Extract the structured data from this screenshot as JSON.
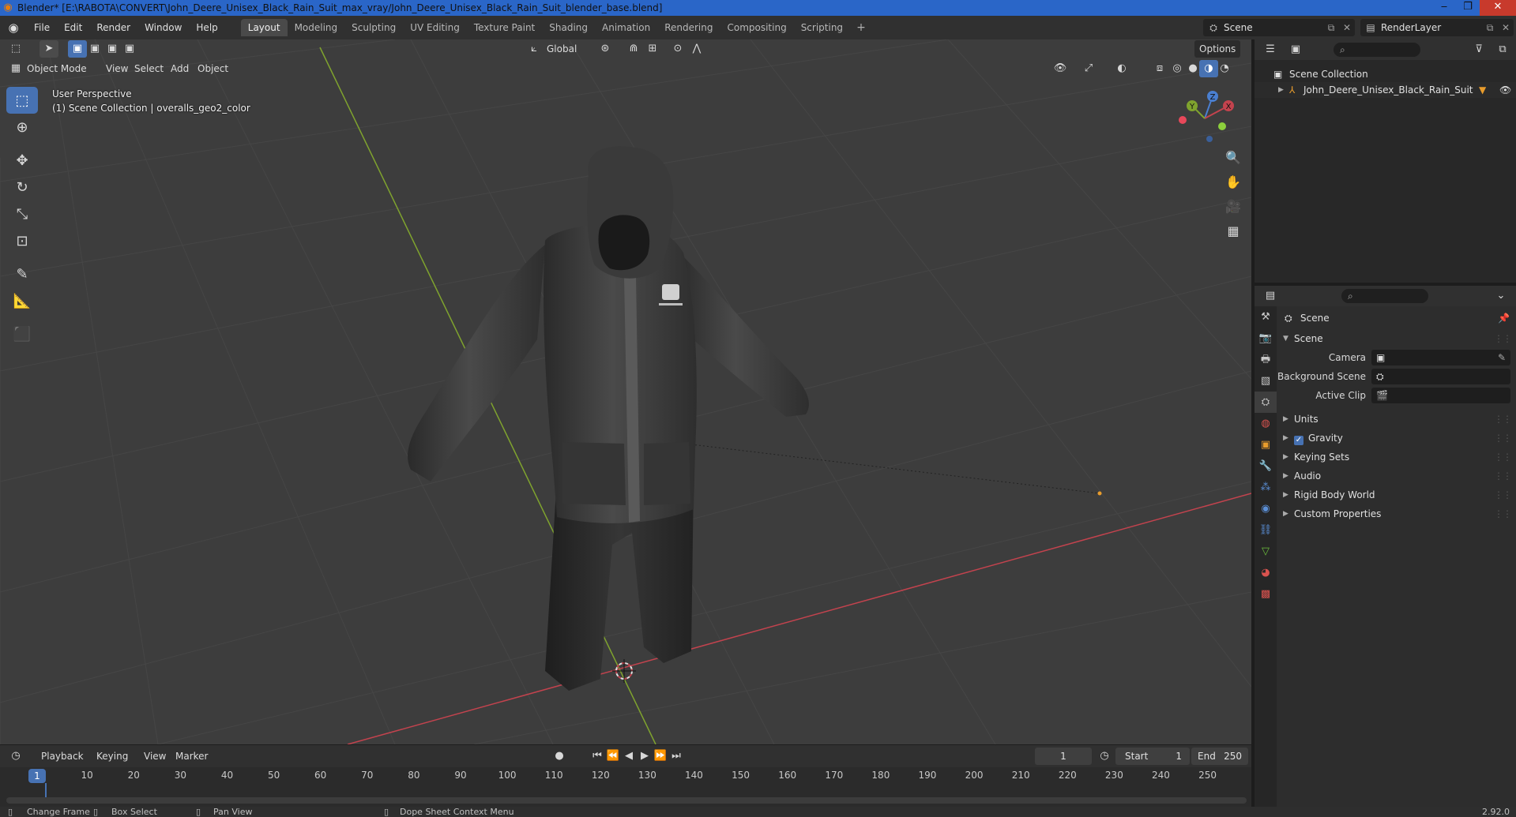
{
  "window": {
    "title": "Blender* [E:\\RABOTA\\CONVERT\\John_Deere_Unisex_Black_Rain_Suit_max_vray/John_Deere_Unisex_Black_Rain_Suit_blender_base.blend]",
    "minimize": "‒",
    "maximize": "❐",
    "close": "✕"
  },
  "menu": [
    "File",
    "Edit",
    "Render",
    "Window",
    "Help"
  ],
  "workspaces": [
    "Layout",
    "Modeling",
    "Sculpting",
    "UV Editing",
    "Texture Paint",
    "Shading",
    "Animation",
    "Rendering",
    "Compositing",
    "Scripting"
  ],
  "active_workspace": "Layout",
  "scene_selector": {
    "value": "Scene"
  },
  "view_layer_selector": {
    "value": "RenderLayer"
  },
  "viewport": {
    "mode": "Object Mode",
    "menus": [
      "View",
      "Select",
      "Add",
      "Object"
    ],
    "orientation": "Global",
    "options": "Options",
    "info_line1": "User Perspective",
    "info_line2": "(1) Scene Collection | overalls_geo2_color",
    "gizmo": {
      "x": "X",
      "y": "Y",
      "z": "Z"
    },
    "colors": {
      "background": "#3d3d3d",
      "grid": "#4a4a4a",
      "x_axis": "#c3434e",
      "y_axis": "#7fa32e",
      "accent": "#4772b3"
    }
  },
  "toolbar": [
    "select-box",
    "cursor",
    "move",
    "rotate",
    "scale",
    "transform",
    "annotate",
    "measure",
    "add-cube"
  ],
  "timeline": {
    "menus": [
      "Playback",
      "Keying",
      "View",
      "Marker"
    ],
    "current_frame": "1",
    "start_label": "Start",
    "start": "1",
    "end_label": "End",
    "end": "250",
    "ticks": [
      "10",
      "20",
      "30",
      "40",
      "50",
      "60",
      "70",
      "80",
      "90",
      "100",
      "110",
      "120",
      "130",
      "140",
      "150",
      "160",
      "170",
      "180",
      "190",
      "200",
      "210",
      "220",
      "230",
      "240",
      "250"
    ]
  },
  "status": {
    "change_frame": "Change Frame",
    "box_select": "Box Select",
    "pan_view": "Pan View",
    "context_menu": "Dope Sheet Context Menu",
    "version": "2.92.0"
  },
  "outliner": {
    "root": "Scene Collection",
    "item": "John_Deere_Unisex_Black_Rain_Suit"
  },
  "properties": {
    "context": "Scene",
    "panel": "Scene",
    "fields": [
      {
        "label": "Camera"
      },
      {
        "label": "Background Scene"
      },
      {
        "label": "Active Clip"
      }
    ],
    "sections": [
      "Units",
      "Gravity",
      "Keying Sets",
      "Audio",
      "Rigid Body World",
      "Custom Properties"
    ],
    "gravity_checked": true
  }
}
